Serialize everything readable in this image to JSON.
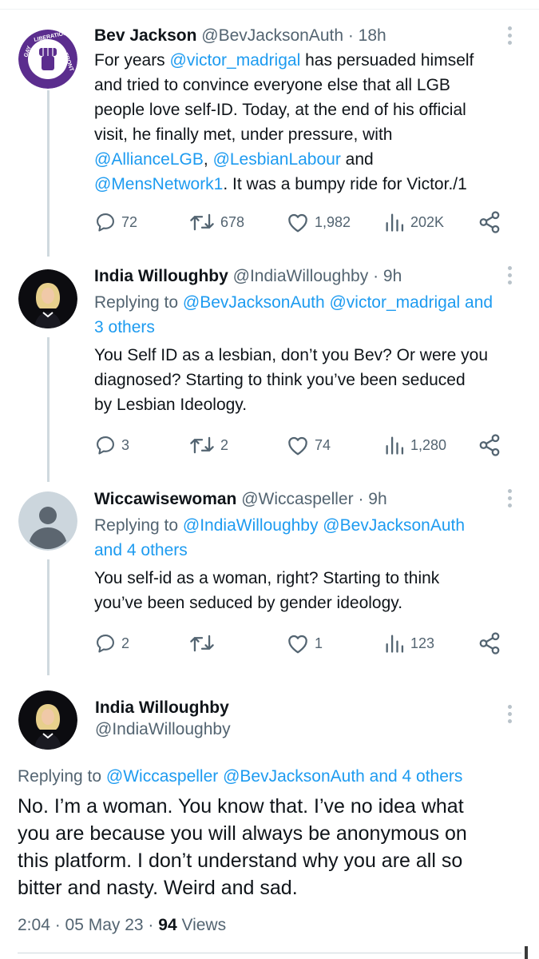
{
  "tweets": [
    {
      "name": "Bev Jackson",
      "handle": "@BevJacksonAuth",
      "time": "· 18h",
      "body": [
        [
          {
            "t": "For years "
          },
          {
            "t": "@victor_madrigal",
            "link": true
          },
          {
            "t": " has persuaded himself"
          }
        ],
        [
          {
            "t": "and tried to convince everyone else that all LGB"
          }
        ],
        [
          {
            "t": "people love self-ID. Today, at the end of his official"
          }
        ],
        [
          {
            "t": "visit, he finally met, under pressure, with"
          }
        ],
        [
          {
            "t": "@AllianceLGB",
            "link": true
          },
          {
            "t": ", "
          },
          {
            "t": "@LesbianLabour",
            "link": true
          },
          {
            "t": " and"
          }
        ],
        [
          {
            "t": "@MensNetwork1",
            "link": true
          },
          {
            "t": ". It was a bumpy ride for Victor./1"
          }
        ]
      ],
      "replies": "72",
      "retweets": "678",
      "likes": "1,982",
      "views": "202K"
    },
    {
      "name": "India Willoughby",
      "handle": "@IndiaWilloughby",
      "time": "· 9h",
      "replying_prefix": "Replying to ",
      "replying_links": [
        "@BevJacksonAuth @victor_madrigal and",
        "3 others"
      ],
      "body": [
        [
          {
            "t": "You Self ID as a lesbian, don’t you Bev? Or were you"
          }
        ],
        [
          {
            "t": "diagnosed? Starting to think you’ve been seduced"
          }
        ],
        [
          {
            "t": "by Lesbian Ideology."
          }
        ]
      ],
      "replies": "3",
      "retweets": "2",
      "likes": "74",
      "views": "1,280"
    },
    {
      "name": "Wiccawisewoman",
      "handle": "@Wiccaspeller",
      "time": "· 9h",
      "replying_prefix": "Replying to ",
      "replying_links": [
        "@IndiaWilloughby @BevJacksonAuth",
        "and 4 others"
      ],
      "body": [
        [
          {
            "t": "You self-id as a woman, right? Starting to think"
          }
        ],
        [
          {
            "t": "you’ve been seduced by gender ideology."
          }
        ]
      ],
      "replies": "2",
      "retweets": "",
      "likes": "1",
      "views": "123"
    }
  ],
  "main": {
    "name": "India Willoughby",
    "handle": "@IndiaWilloughby",
    "replying_prefix": "Replying to ",
    "replying_link": "@Wiccaspeller @BevJacksonAuth and 4 others",
    "body": [
      "No. I’m a woman. You know that. I’ve no idea what",
      "you are because you will always be anonymous on",
      "this platform. I don’t understand why you are all so",
      "bitter and nasty.  Weird and sad."
    ],
    "time_date": "2:04 · 05 May 23 · ",
    "views_count": "94",
    "views_label": " Views"
  },
  "avatar_text": {
    "gay": "GAY",
    "liberation": "LIBERATION",
    "front": "FRONT"
  },
  "colors": {
    "link": "#1d9bf0",
    "muted": "#536471",
    "text": "#0f1419",
    "glf_purple": "#5b2d8e"
  }
}
